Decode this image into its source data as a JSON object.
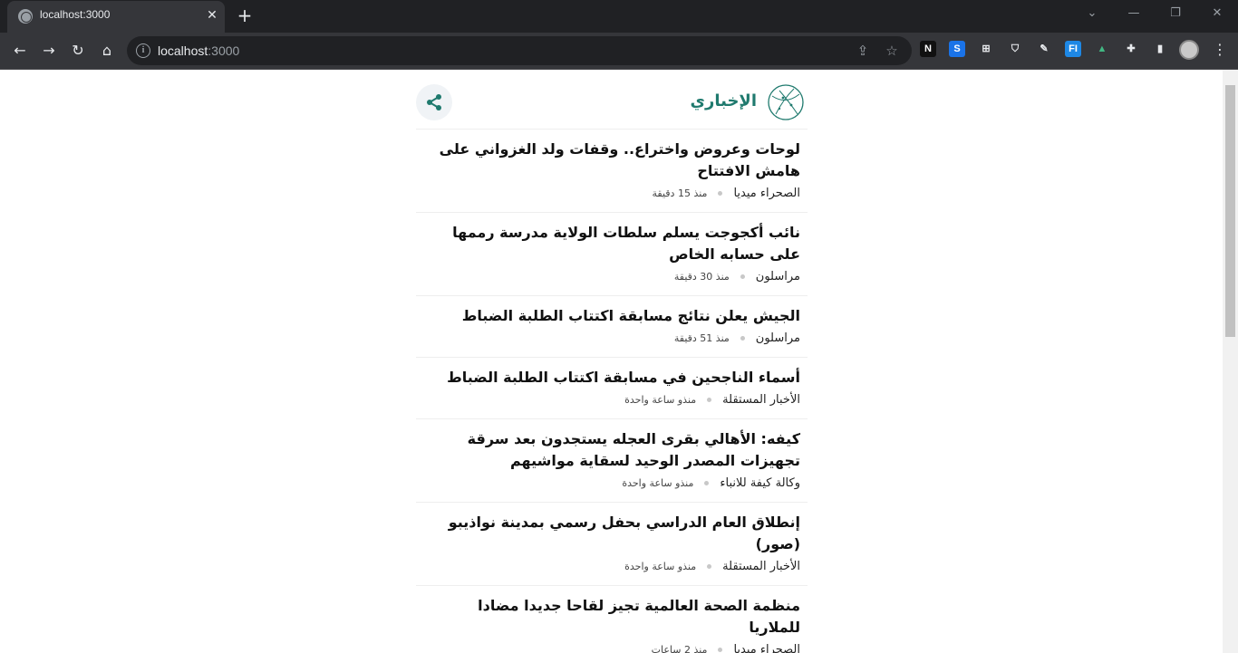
{
  "browser": {
    "tab_title": "localhost:3000",
    "url_host": "localhost",
    "url_port": ":3000",
    "tab_close": "✕",
    "new_tab": "+",
    "window_minimize": "—",
    "window_restore": "❐",
    "window_close": "✕",
    "tab_search": "⌄",
    "back": "←",
    "forward": "→",
    "reload": "↻",
    "home": "⌂",
    "info": "i",
    "share_page": "⇪",
    "bookmark_star": "☆",
    "menu": "⋮",
    "extensions": [
      {
        "name": "notion-extension-icon",
        "label": "N",
        "color": "#ffffff",
        "bg": "#111111"
      },
      {
        "name": "s-extension-icon",
        "label": "S",
        "color": "#ffffff",
        "bg": "#1a73e8"
      },
      {
        "name": "grid-extension-icon",
        "label": "⊞",
        "color": "#e8eaed",
        "bg": "#35363a"
      },
      {
        "name": "shield-extension-icon",
        "label": "⛉",
        "color": "#e8eaed",
        "bg": "#35363a"
      },
      {
        "name": "eyedropper-extension-icon",
        "label": "✎",
        "color": "#e8eaed",
        "bg": "#35363a"
      },
      {
        "name": "fi-extension-icon",
        "label": "FI",
        "color": "#ffffff",
        "bg": "#1e88e5"
      },
      {
        "name": "vue-devtools-extension-icon",
        "label": "▲",
        "color": "#42b883",
        "bg": "#35363a"
      },
      {
        "name": "puzzle-extensions-icon",
        "label": "✚",
        "color": "#e8eaed",
        "bg": "#35363a"
      },
      {
        "name": "side-panel-icon",
        "label": "▮",
        "color": "#e8eaed",
        "bg": "#35363a"
      }
    ]
  },
  "header": {
    "brand": "الإخباري",
    "brand_color": "#1f7a6e",
    "share_color": "#1f7a6e"
  },
  "articles": [
    {
      "title": "لوحات وعروض واختراع.. وقفات ولد الغزواني على هامش الافتتاح",
      "source": "الصحراء ميديا",
      "time": "منذ 15 دقيقة"
    },
    {
      "title": "نائب أكجوجت يسلم سلطات الولاية مدرسة رممها على حسابه الخاص",
      "source": "مراسلون",
      "time": "منذ 30 دقيقة"
    },
    {
      "title": "الجيش يعلن نتائج مسابقة اكتتاب الطلبة الضباط",
      "source": "مراسلون",
      "time": "منذ 51 دقيقة"
    },
    {
      "title": "أسماء الناجحين في مسابقة اكتتاب الطلبة الضباط",
      "source": "الأخبار المستقلة",
      "time": "منذو ساعة واحدة"
    },
    {
      "title": "كيفه: الأهالي بقرى العجله يستجدون بعد سرقة تجهيزات المصدر الوحيد لسقاية مواشيهم",
      "source": "وكالة كيفة للانباء",
      "time": "منذو ساعة واحدة"
    },
    {
      "title": "إنطلاق العام الدراسي بحفل رسمي بمدينة نواذيبو (صور)",
      "source": "الأخبار المستقلة",
      "time": "منذو ساعة واحدة"
    },
    {
      "title": "منظمة الصحة العالمية تجيز لقاحا جديدا مضادا للملاريا",
      "source": "الصحراء ميديا",
      "time": "منذ 2 ساعات"
    }
  ]
}
